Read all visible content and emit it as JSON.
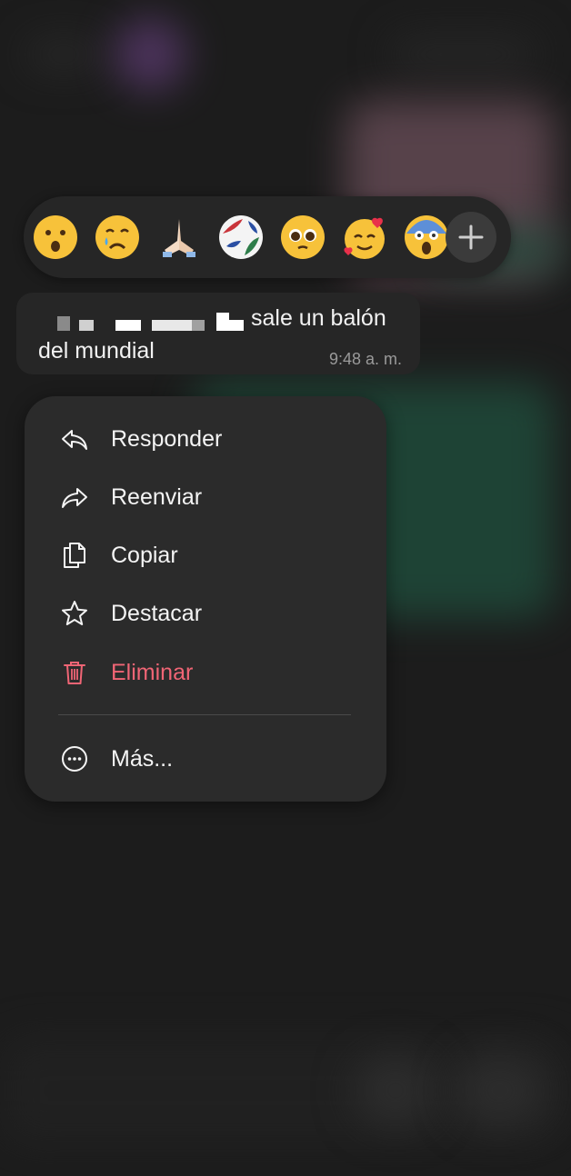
{
  "reactions": {
    "emojis": [
      {
        "icon": "astonished-face-icon",
        "label": "😮"
      },
      {
        "icon": "crying-face-icon",
        "label": "😢"
      },
      {
        "icon": "folded-hands-icon",
        "label": "🙏"
      },
      {
        "icon": "soccer-ball-icon",
        "label": "⚽"
      },
      {
        "icon": "pleading-face-icon",
        "label": "🥺"
      },
      {
        "icon": "smiling-face-with-hearts-icon",
        "label": "🥰"
      },
      {
        "icon": "screaming-face-icon",
        "label": "😱"
      }
    ],
    "more_icon": "plus-icon"
  },
  "message": {
    "line1": "sale un balón",
    "line2": "del mundial",
    "time": "9:48 a. m."
  },
  "menu": {
    "items": [
      {
        "label": "Responder",
        "icon": "reply-icon"
      },
      {
        "label": "Reenviar",
        "icon": "forward-icon"
      },
      {
        "label": "Copiar",
        "icon": "copy-icon"
      },
      {
        "label": "Destacar",
        "icon": "star-icon"
      },
      {
        "label": "Eliminar",
        "icon": "trash-icon"
      },
      {
        "label": "Más...",
        "icon": "more-icon"
      }
    ]
  },
  "colors": {
    "background": "#1c1c1c",
    "panel": "#2b2b2b",
    "danger": "#f06575",
    "emoji_yellow": "#f7c23a"
  }
}
